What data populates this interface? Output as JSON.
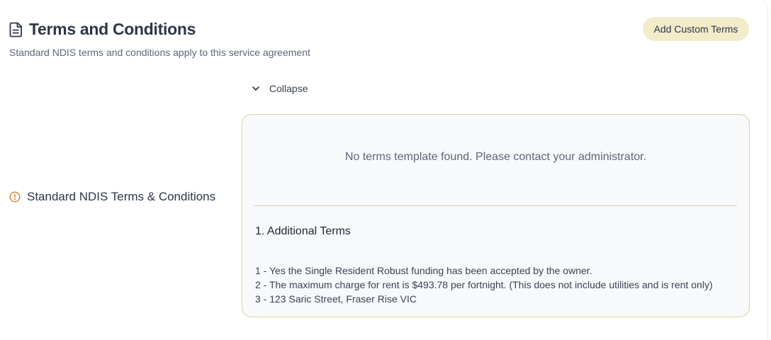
{
  "header": {
    "title": "Terms and Conditions",
    "subtitle": "Standard NDIS terms and conditions apply to this service agreement",
    "add_button_label": "Add Custom Terms",
    "title_icon": "document-icon"
  },
  "section": {
    "label": "Standard NDIS Terms & Conditions",
    "label_icon": "alert-circle-icon",
    "collapse_label": "Collapse",
    "collapse_icon": "chevron-down-icon"
  },
  "terms_box": {
    "empty_message": "No terms template found. Please contact your administrator.",
    "additional_heading": "1. Additional Terms",
    "lines": [
      "1 - Yes the Single Resident Robust funding has been accepted by the owner.",
      "2 - The maximum charge for rent is $493.78 per fortnight. (This does not include utilities and is rent only)",
      "3 - 123 Saric Street, Fraser Rise VIC"
    ]
  },
  "colors": {
    "accent_button": "#f2ecca",
    "box_border": "#d9d3a8",
    "warning": "#d9822b",
    "text_primary": "#2e3647",
    "text_muted": "#5d6678"
  }
}
